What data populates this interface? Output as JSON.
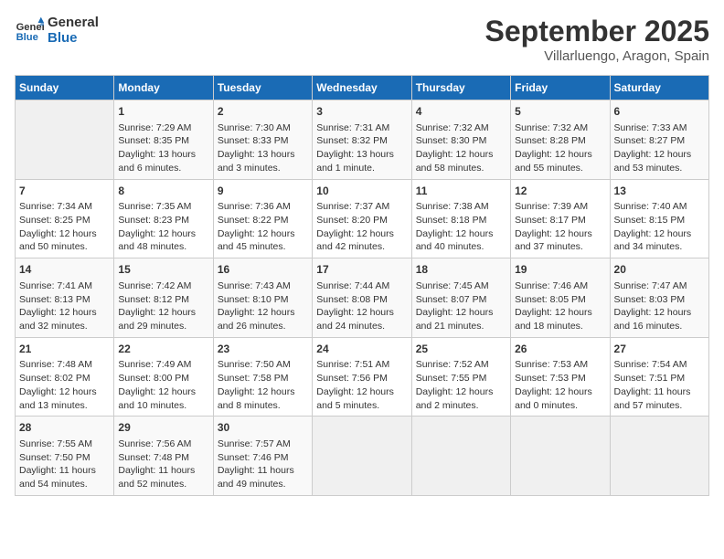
{
  "logo": {
    "line1": "General",
    "line2": "Blue"
  },
  "title": "September 2025",
  "subtitle": "Villarluengo, Aragon, Spain",
  "days_of_week": [
    "Sunday",
    "Monday",
    "Tuesday",
    "Wednesday",
    "Thursday",
    "Friday",
    "Saturday"
  ],
  "weeks": [
    [
      {
        "day": "",
        "info": ""
      },
      {
        "day": "1",
        "info": "Sunrise: 7:29 AM\nSunset: 8:35 PM\nDaylight: 13 hours\nand 6 minutes."
      },
      {
        "day": "2",
        "info": "Sunrise: 7:30 AM\nSunset: 8:33 PM\nDaylight: 13 hours\nand 3 minutes."
      },
      {
        "day": "3",
        "info": "Sunrise: 7:31 AM\nSunset: 8:32 PM\nDaylight: 13 hours\nand 1 minute."
      },
      {
        "day": "4",
        "info": "Sunrise: 7:32 AM\nSunset: 8:30 PM\nDaylight: 12 hours\nand 58 minutes."
      },
      {
        "day": "5",
        "info": "Sunrise: 7:32 AM\nSunset: 8:28 PM\nDaylight: 12 hours\nand 55 minutes."
      },
      {
        "day": "6",
        "info": "Sunrise: 7:33 AM\nSunset: 8:27 PM\nDaylight: 12 hours\nand 53 minutes."
      }
    ],
    [
      {
        "day": "7",
        "info": "Sunrise: 7:34 AM\nSunset: 8:25 PM\nDaylight: 12 hours\nand 50 minutes."
      },
      {
        "day": "8",
        "info": "Sunrise: 7:35 AM\nSunset: 8:23 PM\nDaylight: 12 hours\nand 48 minutes."
      },
      {
        "day": "9",
        "info": "Sunrise: 7:36 AM\nSunset: 8:22 PM\nDaylight: 12 hours\nand 45 minutes."
      },
      {
        "day": "10",
        "info": "Sunrise: 7:37 AM\nSunset: 8:20 PM\nDaylight: 12 hours\nand 42 minutes."
      },
      {
        "day": "11",
        "info": "Sunrise: 7:38 AM\nSunset: 8:18 PM\nDaylight: 12 hours\nand 40 minutes."
      },
      {
        "day": "12",
        "info": "Sunrise: 7:39 AM\nSunset: 8:17 PM\nDaylight: 12 hours\nand 37 minutes."
      },
      {
        "day": "13",
        "info": "Sunrise: 7:40 AM\nSunset: 8:15 PM\nDaylight: 12 hours\nand 34 minutes."
      }
    ],
    [
      {
        "day": "14",
        "info": "Sunrise: 7:41 AM\nSunset: 8:13 PM\nDaylight: 12 hours\nand 32 minutes."
      },
      {
        "day": "15",
        "info": "Sunrise: 7:42 AM\nSunset: 8:12 PM\nDaylight: 12 hours\nand 29 minutes."
      },
      {
        "day": "16",
        "info": "Sunrise: 7:43 AM\nSunset: 8:10 PM\nDaylight: 12 hours\nand 26 minutes."
      },
      {
        "day": "17",
        "info": "Sunrise: 7:44 AM\nSunset: 8:08 PM\nDaylight: 12 hours\nand 24 minutes."
      },
      {
        "day": "18",
        "info": "Sunrise: 7:45 AM\nSunset: 8:07 PM\nDaylight: 12 hours\nand 21 minutes."
      },
      {
        "day": "19",
        "info": "Sunrise: 7:46 AM\nSunset: 8:05 PM\nDaylight: 12 hours\nand 18 minutes."
      },
      {
        "day": "20",
        "info": "Sunrise: 7:47 AM\nSunset: 8:03 PM\nDaylight: 12 hours\nand 16 minutes."
      }
    ],
    [
      {
        "day": "21",
        "info": "Sunrise: 7:48 AM\nSunset: 8:02 PM\nDaylight: 12 hours\nand 13 minutes."
      },
      {
        "day": "22",
        "info": "Sunrise: 7:49 AM\nSunset: 8:00 PM\nDaylight: 12 hours\nand 10 minutes."
      },
      {
        "day": "23",
        "info": "Sunrise: 7:50 AM\nSunset: 7:58 PM\nDaylight: 12 hours\nand 8 minutes."
      },
      {
        "day": "24",
        "info": "Sunrise: 7:51 AM\nSunset: 7:56 PM\nDaylight: 12 hours\nand 5 minutes."
      },
      {
        "day": "25",
        "info": "Sunrise: 7:52 AM\nSunset: 7:55 PM\nDaylight: 12 hours\nand 2 minutes."
      },
      {
        "day": "26",
        "info": "Sunrise: 7:53 AM\nSunset: 7:53 PM\nDaylight: 12 hours\nand 0 minutes."
      },
      {
        "day": "27",
        "info": "Sunrise: 7:54 AM\nSunset: 7:51 PM\nDaylight: 11 hours\nand 57 minutes."
      }
    ],
    [
      {
        "day": "28",
        "info": "Sunrise: 7:55 AM\nSunset: 7:50 PM\nDaylight: 11 hours\nand 54 minutes."
      },
      {
        "day": "29",
        "info": "Sunrise: 7:56 AM\nSunset: 7:48 PM\nDaylight: 11 hours\nand 52 minutes."
      },
      {
        "day": "30",
        "info": "Sunrise: 7:57 AM\nSunset: 7:46 PM\nDaylight: 11 hours\nand 49 minutes."
      },
      {
        "day": "",
        "info": ""
      },
      {
        "day": "",
        "info": ""
      },
      {
        "day": "",
        "info": ""
      },
      {
        "day": "",
        "info": ""
      }
    ]
  ]
}
